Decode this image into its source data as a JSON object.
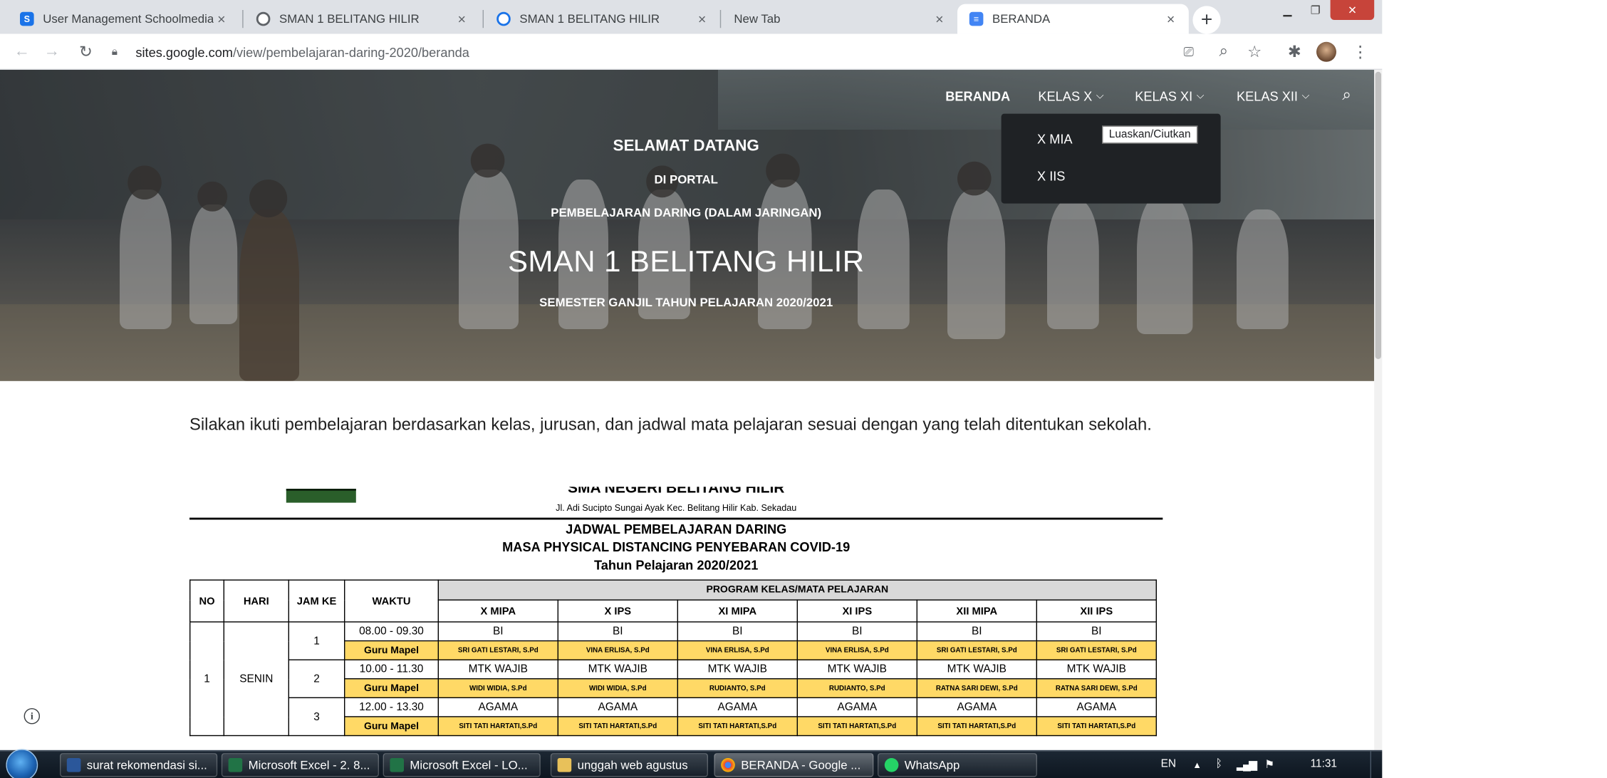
{
  "browser": {
    "tabs": [
      {
        "title": "User Management Schoolmedia",
        "favicon_color": "#1a73e8"
      },
      {
        "title": "SMAN 1 BELITANG HILIR",
        "favicon_color": "#5f6368"
      },
      {
        "title": "SMAN 1 BELITANG HILIR",
        "favicon_color": "#1a73e8"
      },
      {
        "title": "New Tab",
        "favicon_color": ""
      },
      {
        "title": "BERANDA",
        "favicon_color": "#4285f4",
        "active": true
      }
    ],
    "new_tab_symbol": "+",
    "close_symbol": "×",
    "url_host": "sites.google.com",
    "url_path": "/view/pembelajaran-daring-2020/beranda",
    "toolbar_icons": [
      "back-icon",
      "forward-icon",
      "reload-icon",
      "lock-icon",
      "cast-icon",
      "zoom-icon",
      "star-icon",
      "extensions-icon",
      "profile-avatar",
      "menu-icon"
    ]
  },
  "site": {
    "nav": {
      "home": "BERANDA",
      "kelas_x": "KELAS X",
      "kelas_xi": "KELAS XI",
      "kelas_xii": "KELAS XII",
      "search_icon": "search-icon"
    },
    "dropdown": {
      "items": [
        "X MIA",
        "X IIS"
      ],
      "tooltip": "Luaskan/Ciutkan"
    },
    "hero": {
      "welcome": "SELAMAT DATANG",
      "portal": "DI PORTAL",
      "daring": "PEMBELAJARAN DARING (DALAM JARINGAN)",
      "school": "SMAN 1 BELITANG HILIR",
      "semester": "SEMESTER GANJIL TAHUN PELAJARAN 2020/2021"
    },
    "intro": "Silakan ikuti pembelajaran berdasarkan kelas, jurusan, dan jadwal mata pelajaran sesuai dengan yang telah ditentukan sekolah."
  },
  "schedule": {
    "school_name": "SMA NEGERI BELITANG HILIR",
    "address": "Jl. Adi Sucipto Sungai Ayak Kec. Belitang Hilir Kab. Sekadau",
    "title": "JADWAL PEMBELAJARAN DARING",
    "subtitle": "MASA PHYSICAL DISTANCING PENYEBARAN COVID-19",
    "year": "Tahun Pelajaran 2020/2021",
    "headers": {
      "no": "NO",
      "hari": "HARI",
      "jam_ke": "JAM KE",
      "waktu": "WAKTU",
      "program": "PROGRAM KELAS/MATA PELAJARAN",
      "classes": [
        "X MIPA",
        "X IPS",
        "XI MIPA",
        "XI IPS",
        "XII MIPA",
        "XII IPS"
      ]
    },
    "rows": {
      "no": "1",
      "hari": "SENIN",
      "guru_label": "Guru Mapel",
      "periods": [
        {
          "jam": "1",
          "waktu": "08.00 - 09.30",
          "subjects": [
            "BI",
            "BI",
            "BI",
            "BI",
            "BI",
            "BI"
          ],
          "teachers": [
            "SRI GATI LESTARI, S.Pd",
            "VINA ERLISA, S.Pd",
            "VINA ERLISA, S.Pd",
            "VINA ERLISA, S.Pd",
            "SRI GATI LESTARI, S.Pd",
            "SRI GATI LESTARI, S.Pd"
          ]
        },
        {
          "jam": "2",
          "waktu": "10.00 - 11.30",
          "subjects": [
            "MTK  WAJIB",
            "MTK WAJIB",
            "MTK  WAJIB",
            "MTK  WAJIB",
            "MTK  WAJIB",
            "MTK  WAJIB"
          ],
          "teachers": [
            "WIDI WIDIA, S.Pd",
            "WIDI WIDIA, S.Pd",
            "RUDIANTO, S.Pd",
            "RUDIANTO, S.Pd",
            "RATNA SARI DEWI, S.Pd",
            "RATNA SARI DEWI, S.Pd"
          ]
        },
        {
          "jam": "3",
          "waktu": "12.00 - 13.30",
          "subjects": [
            "AGAMA",
            "AGAMA",
            "AGAMA",
            "AGAMA",
            "AGAMA",
            "AGAMA"
          ],
          "teachers": [
            "SITI TATI HARTATI,S.Pd",
            "SITI TATI HARTATI,S.Pd",
            "SITI TATI HARTATI,S.Pd",
            "SITI TATI HARTATI,S.Pd",
            "SITI TATI HARTATI,S.Pd",
            "SITI TATI HARTATI,S.Pd"
          ]
        }
      ]
    }
  },
  "taskbar": {
    "items": [
      {
        "label": "surat rekomendasi si...",
        "icon_color": "#2b579a"
      },
      {
        "label": "Microsoft Excel - 2. 8...",
        "icon_color": "#217346"
      },
      {
        "label": "Microsoft Excel - LO...",
        "icon_color": "#217346"
      },
      {
        "label": "unggah web agustus",
        "icon_color": "#e8c15a"
      },
      {
        "label": "BERANDA - Google ...",
        "icon_color": "#ea4335",
        "active": true
      },
      {
        "label": "WhatsApp",
        "icon_color": "#25d366"
      }
    ],
    "lang": "EN",
    "clock": "11:31"
  },
  "colors": {
    "tabstrip": "#dee1e6",
    "dropdown_bg": "#1f2225",
    "schedule_yellow": "#ffd966",
    "taskbar": "#0d1620"
  }
}
